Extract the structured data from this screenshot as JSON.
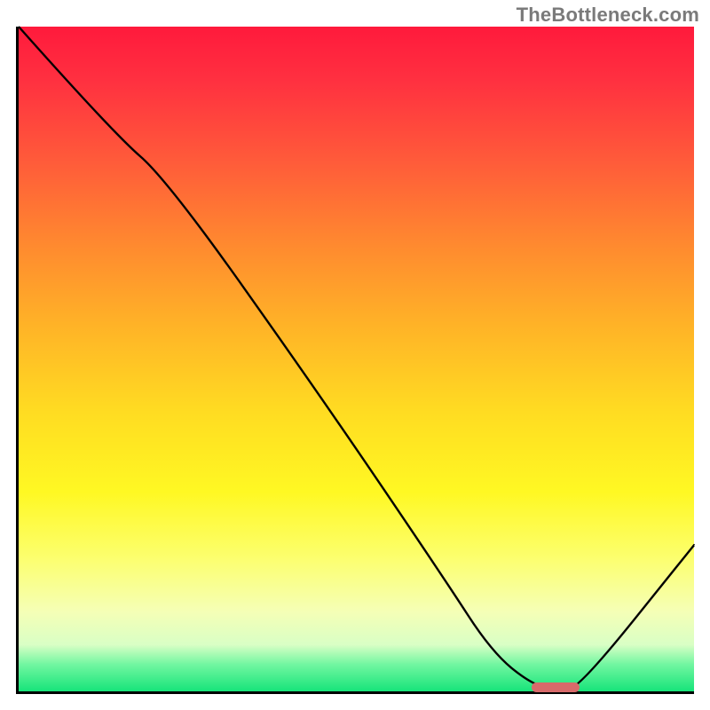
{
  "watermark": "TheBottleneck.com",
  "chart_data": {
    "type": "line",
    "title": "",
    "xlabel": "",
    "ylabel": "",
    "xlim": [
      0,
      100
    ],
    "ylim": [
      0,
      100
    ],
    "grid": false,
    "series": [
      {
        "name": "curve",
        "x": [
          0,
          14,
          22,
          45,
          63,
          70,
          76,
          80,
          83,
          100
        ],
        "values": [
          100,
          84,
          77,
          44,
          17,
          6,
          1,
          0.2,
          0.5,
          22
        ]
      }
    ],
    "marker": {
      "x_start": 76,
      "x_end": 83,
      "y": 0.5,
      "color": "#d86a6a"
    },
    "gradient_stops": [
      {
        "pos": 0,
        "color": "#ff1a3c"
      },
      {
        "pos": 8,
        "color": "#ff3040"
      },
      {
        "pos": 20,
        "color": "#ff5a3a"
      },
      {
        "pos": 33,
        "color": "#ff8a2f"
      },
      {
        "pos": 45,
        "color": "#ffb327"
      },
      {
        "pos": 58,
        "color": "#ffdc22"
      },
      {
        "pos": 70,
        "color": "#fff823"
      },
      {
        "pos": 80,
        "color": "#fcff6f"
      },
      {
        "pos": 88,
        "color": "#f5ffb6"
      },
      {
        "pos": 93,
        "color": "#d9ffc5"
      },
      {
        "pos": 96,
        "color": "#70f6a0"
      },
      {
        "pos": 100,
        "color": "#16e47a"
      }
    ]
  }
}
